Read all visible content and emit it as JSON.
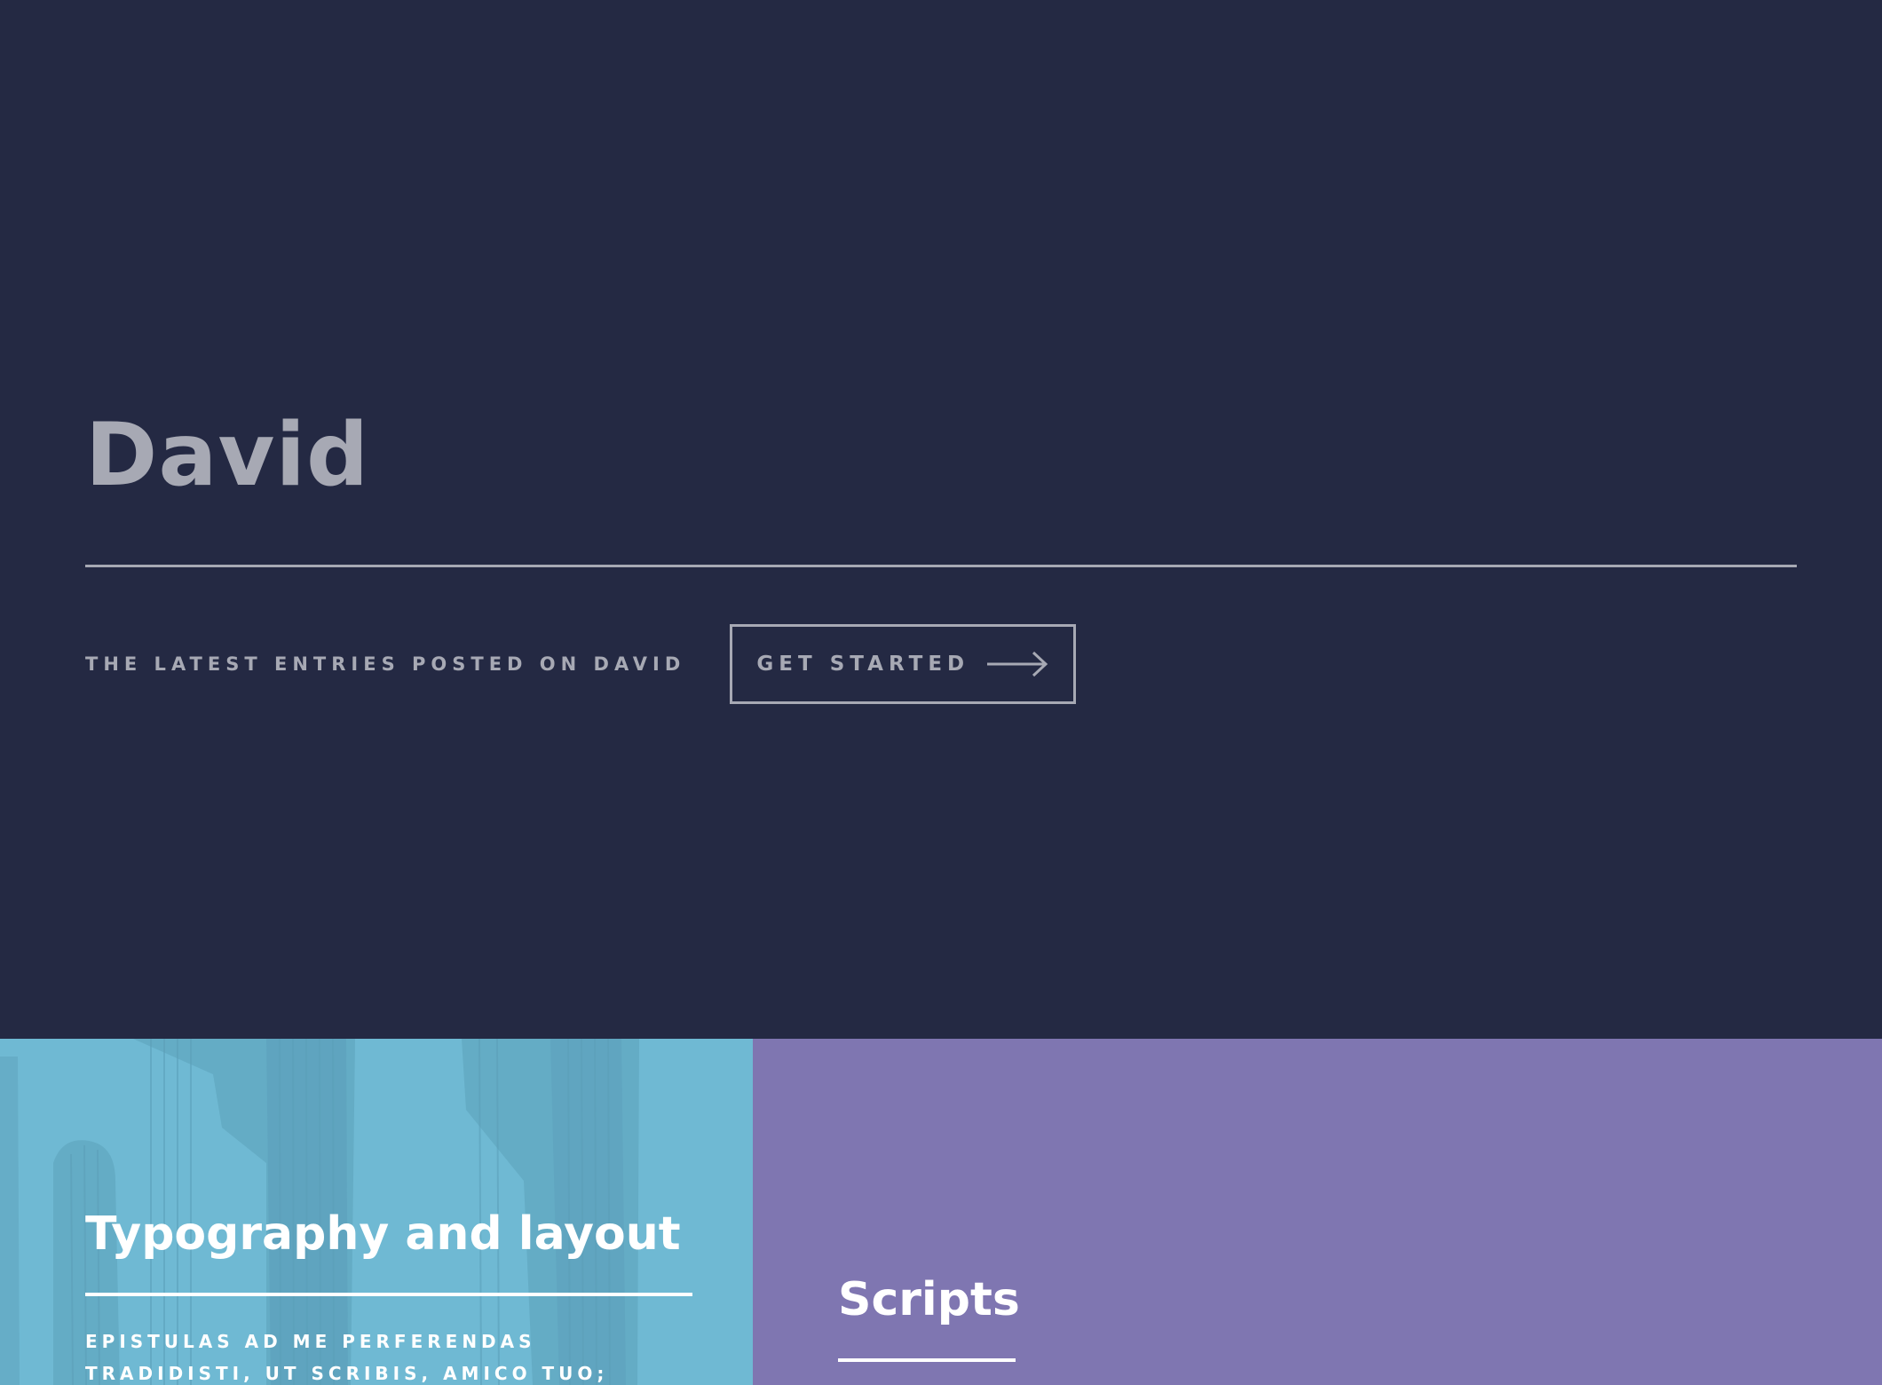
{
  "banner": {
    "title": "David",
    "tagline": "THE LATEST ENTRIES POSTED ON DAVID",
    "cta_label": "GET STARTED",
    "cta_icon": "arrow-right-icon"
  },
  "tiles": [
    {
      "title": "Typography and layout",
      "description": "EPISTULAS AD ME PERFERENDAS TRADIDISTI, UT SCRIBIS, AMICO TUO; DEINDE ADMONES",
      "background_color": "#6fb9d3",
      "image": "cactus"
    },
    {
      "title": "Scripts",
      "background_color": "#7f76b1"
    }
  ],
  "colors": {
    "banner_bg": "#242943",
    "banner_text": "#a7a9b4",
    "tile_text": "#ffffff"
  }
}
